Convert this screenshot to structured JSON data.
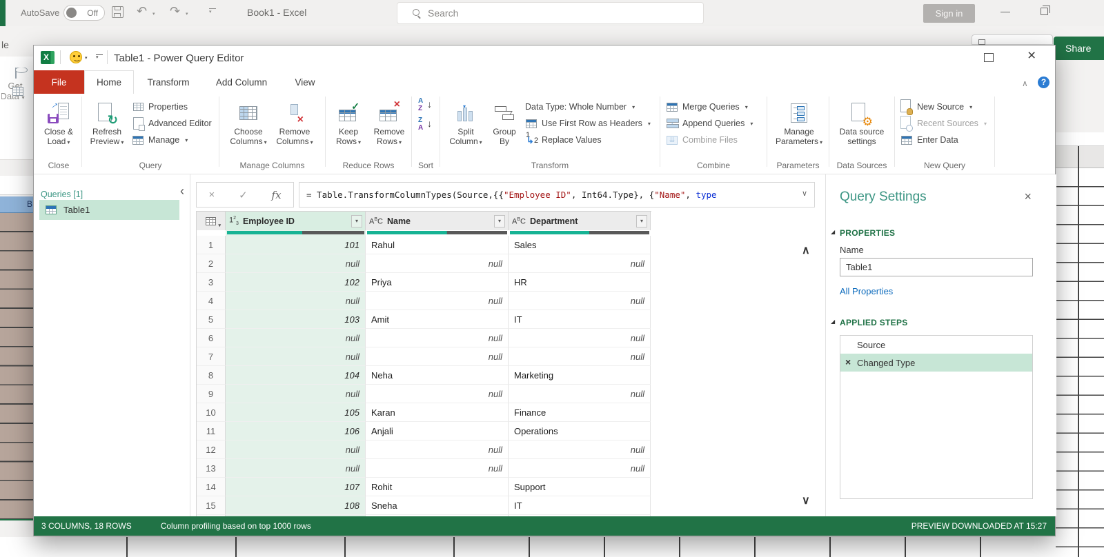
{
  "excel_background": {
    "topbar": {
      "autosave_label": "AutoSave",
      "autosave_state": "Off",
      "workbook_title": "Book1 - Excel",
      "search_placeholder": "Search",
      "sign_in_label": "Sign in"
    },
    "ribbon": {
      "file_tab_partial": "le",
      "get_data_line1": "Get",
      "get_data_line2": "Data",
      "share_label": "Share"
    },
    "sheet": {
      "column_header_letter": "B"
    }
  },
  "power_query": {
    "window_title": "Table1 - Power Query Editor",
    "tabs": [
      {
        "label": "File"
      },
      {
        "label": "Home"
      },
      {
        "label": "Transform"
      },
      {
        "label": "Add Column"
      },
      {
        "label": "View"
      }
    ],
    "ribbon": {
      "close_group": {
        "label": "Close",
        "close_and_load": "Close & Load"
      },
      "query_group": {
        "label": "Query",
        "refresh_preview": "Refresh Preview",
        "properties": "Properties",
        "advanced_editor": "Advanced Editor",
        "manage": "Manage"
      },
      "manage_columns_group": {
        "label": "Manage Columns",
        "choose_columns": "Choose Columns",
        "remove_columns": "Remove Columns"
      },
      "reduce_rows_group": {
        "label": "Reduce Rows",
        "keep_rows": "Keep Rows",
        "remove_rows": "Remove Rows"
      },
      "sort_group": {
        "label": "Sort"
      },
      "transform_group": {
        "label": "Transform",
        "split_column": "Split Column",
        "group_by": "Group By",
        "data_type": "Data Type: Whole Number",
        "use_first_row": "Use First Row as Headers",
        "replace_values": "Replace Values"
      },
      "combine_group": {
        "label": "Combine",
        "merge_queries": "Merge Queries",
        "append_queries": "Append Queries",
        "combine_files": "Combine Files"
      },
      "parameters_group": {
        "label": "Parameters",
        "manage_parameters": "Manage Parameters"
      },
      "data_sources_group": {
        "label": "Data Sources",
        "data_source_settings": "Data source settings"
      },
      "new_query_group": {
        "label": "New Query",
        "new_source": "New Source",
        "recent_sources": "Recent Sources",
        "enter_data": "Enter Data"
      }
    },
    "queries_pane": {
      "header": "Queries [1]",
      "items": [
        {
          "name": "Table1",
          "selected": true
        }
      ]
    },
    "formula_bar": {
      "segments": [
        {
          "text": "= Table.TransformColumnTypes(Source,{{",
          "kind": "plain"
        },
        {
          "text": "\"Employee ID\"",
          "kind": "string"
        },
        {
          "text": ", Int64.Type}, {",
          "kind": "plain"
        },
        {
          "text": "\"Name\"",
          "kind": "string"
        },
        {
          "text": ", ",
          "kind": "plain"
        },
        {
          "text": "type",
          "kind": "keyword"
        }
      ]
    },
    "grid": {
      "columns": [
        {
          "type": "123",
          "name": "Employee ID",
          "selected": true,
          "valid_pct": 55
        },
        {
          "type": "ABC",
          "name": "Name",
          "selected": false,
          "valid_pct": 57
        },
        {
          "type": "ABC",
          "name": "Department",
          "selected": false,
          "valid_pct": 57
        }
      ],
      "rows": [
        [
          "1",
          "101",
          "Rahul",
          "Sales"
        ],
        [
          "2",
          "null",
          "null",
          "null"
        ],
        [
          "3",
          "102",
          "Priya",
          "HR"
        ],
        [
          "4",
          "null",
          "null",
          "null"
        ],
        [
          "5",
          "103",
          "Amit",
          "IT"
        ],
        [
          "6",
          "null",
          "null",
          "null"
        ],
        [
          "7",
          "null",
          "null",
          "null"
        ],
        [
          "8",
          "104",
          "Neha",
          "Marketing"
        ],
        [
          "9",
          "null",
          "null",
          "null"
        ],
        [
          "10",
          "105",
          "Karan",
          "Finance"
        ],
        [
          "11",
          "106",
          "Anjali",
          "Operations"
        ],
        [
          "12",
          "null",
          "null",
          "null"
        ],
        [
          "13",
          "null",
          "null",
          "null"
        ],
        [
          "14",
          "107",
          "Rohit",
          "Support"
        ],
        [
          "15",
          "108",
          "Sneha",
          "IT"
        ]
      ]
    },
    "query_settings": {
      "title": "Query Settings",
      "properties_header": "PROPERTIES",
      "name_label": "Name",
      "name_value": "Table1",
      "all_properties_link": "All Properties",
      "applied_steps_header": "APPLIED STEPS",
      "steps": [
        {
          "name": "Source",
          "selected": false,
          "removable": false
        },
        {
          "name": "Changed Type",
          "selected": true,
          "removable": true
        }
      ]
    },
    "status_bar": {
      "columns_rows": "3 COLUMNS, 18 ROWS",
      "profiling": "Column profiling based on top 1000 rows",
      "preview": "PREVIEW DOWNLOADED AT 15:27"
    }
  },
  "colors": {
    "excel_green": "#217346",
    "file_tab_red": "#c5331f",
    "accent_teal": "#3b9583",
    "section_green": "#1e7145",
    "selection_green": "#c7e6d6",
    "column_tint": "#e4f2ea",
    "quality_teal": "#16b394",
    "quality_gray": "#595959",
    "link_blue": "#0f6cbd",
    "formula_string_red": "#a31515",
    "formula_keyword_blue": "#0b2fd4"
  }
}
